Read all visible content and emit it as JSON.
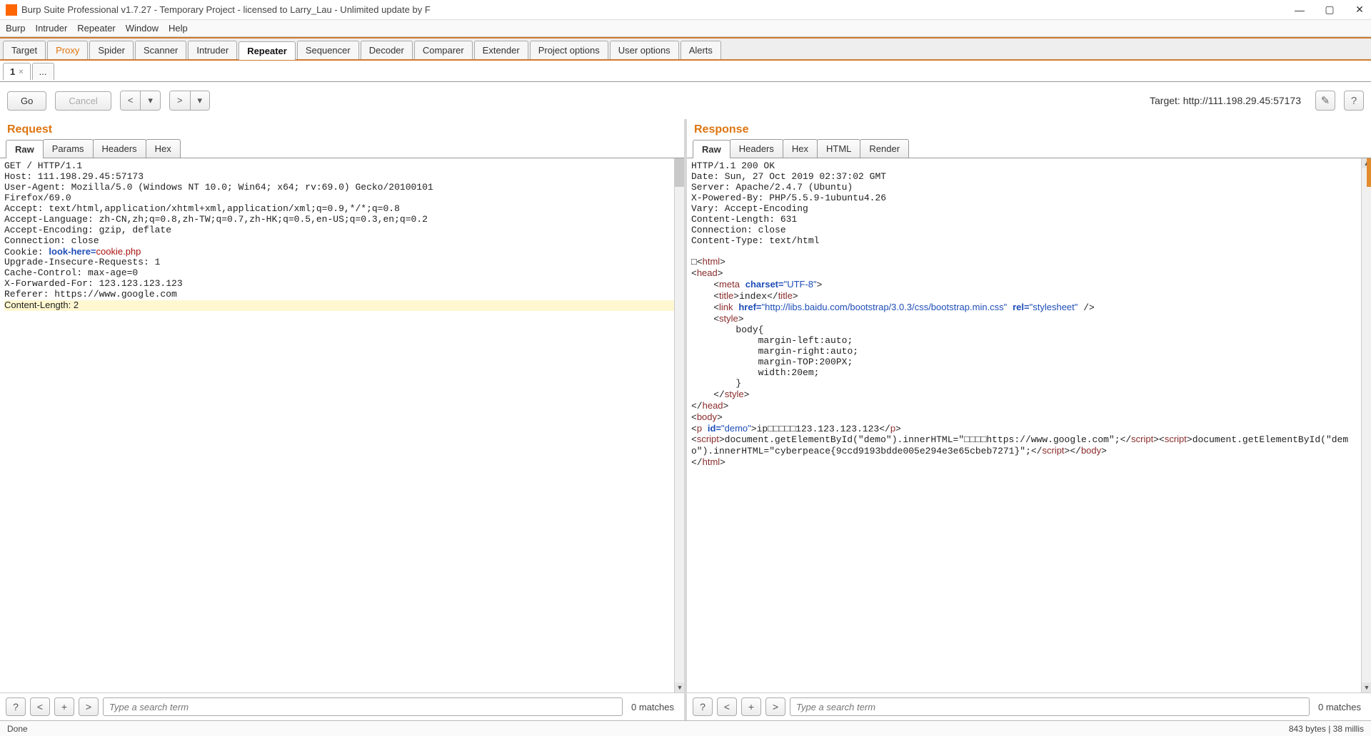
{
  "window": {
    "title": "Burp Suite Professional v1.7.27 - Temporary Project - licensed to Larry_Lau - Unlimited update by F"
  },
  "menubar": {
    "items": [
      "Burp",
      "Intruder",
      "Repeater",
      "Window",
      "Help"
    ]
  },
  "main_tabs": [
    "Target",
    "Proxy",
    "Spider",
    "Scanner",
    "Intruder",
    "Repeater",
    "Sequencer",
    "Decoder",
    "Comparer",
    "Extender",
    "Project options",
    "User options",
    "Alerts"
  ],
  "main_tab_active_index": 5,
  "sub_tabs": {
    "tab1": "1",
    "extra": "..."
  },
  "actions": {
    "go": "Go",
    "cancel": "Cancel",
    "target_label": "Target: http://111.198.29.45:57173"
  },
  "request": {
    "title": "Request",
    "tabs": [
      "Raw",
      "Params",
      "Headers",
      "Hex"
    ],
    "active": 0,
    "body_plain": "GET / HTTP/1.1\nHost: 111.198.29.45:57173\nUser-Agent: Mozilla/5.0 (Windows NT 10.0; Win64; x64; rv:69.0) Gecko/20100101\nFirefox/69.0\nAccept: text/html,application/xhtml+xml,application/xml;q=0.9,*/*;q=0.8\nAccept-Language: zh-CN,zh;q=0.8,zh-TW;q=0.7,zh-HK;q=0.5,en-US;q=0.3,en;q=0.2\nAccept-Encoding: gzip, deflate\nConnection: close\nCookie: ",
    "cookie_key": "look-here=",
    "cookie_val": "cookie.php",
    "body_after_cookie": "\nUpgrade-Insecure-Requests: 1\nCache-Control: max-age=0\nX-Forwarded-For: 123.123.123.123\nReferer: https://www.google.com\n",
    "content_length_line": "Content-Length: 2",
    "search_placeholder": "Type a search term",
    "matches": "0 matches"
  },
  "response": {
    "title": "Response",
    "tabs": [
      "Raw",
      "Headers",
      "Hex",
      "HTML",
      "Render"
    ],
    "active": 0,
    "headers": "HTTP/1.1 200 OK\nDate: Sun, 27 Oct 2019 02:37:02 GMT\nServer: Apache/2.4.7 (Ubuntu)\nX-Powered-By: PHP/5.5.9-1ubuntu4.26\nVary: Accept-Encoding\nContent-Length: 631\nConnection: close\nContent-Type: text/html\n\n",
    "html_lines": {
      "l1": "□<html>",
      "l2": "<head>",
      "l3a": "    <meta ",
      "l3b": "charset=",
      "l3c": "\"UTF-8\"",
      "l3d": ">",
      "l4a": "    <title>",
      "l4b": "index",
      "l4c": "</title>",
      "l5a": "    <link ",
      "l5b": "href=",
      "l5c": "\"http://libs.baidu.com/bootstrap/3.0.3/css/bootstrap.min.css\"",
      "l5d": " rel=",
      "l5e": "\"stylesheet\"",
      "l5f": " />",
      "l6": "    <style>",
      "l7": "        body{",
      "l8": "            margin-left:auto;",
      "l9": "            margin-right:auto;",
      "l10": "            margin-TOP:200PX;",
      "l11": "            width:20em;",
      "l12": "        }",
      "l13": "    </style>",
      "l14": "</head>",
      "l15": "<body>",
      "l16a": "<p ",
      "l16b": "id=",
      "l16c": "\"demo\"",
      "l16d": ">ip□□□□□123.123.123.123</p>",
      "l17a": "<script>",
      "l17b": "document.getElementById(\"demo\").innerHTML=\"□□□□https://www.google.com\";",
      "l17c": "</scr",
      "l17d": "ipt><script>",
      "l17e": "document.getElementById(\"demo\").innerHTML=\"cyberpeace{9ccd9193bdde005e294e3e65cbeb7271}\";",
      "l17f": "</scr",
      "l17g": "ipt></body>",
      "l18": "</html>"
    },
    "search_placeholder": "Type a search term",
    "matches": "0 matches"
  },
  "status": {
    "left": "Done",
    "right": "843 bytes | 38 millis"
  }
}
